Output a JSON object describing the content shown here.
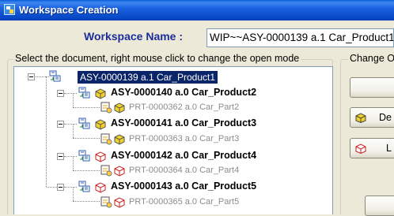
{
  "window": {
    "title": "Workspace Creation",
    "icon": "app-icon"
  },
  "workspace": {
    "label": "Workspace Name :",
    "value": "WIP~~ASY-0000139 a.1 Car_Product1"
  },
  "document_group": {
    "label": "Select the document, right mouse click to change the open mode"
  },
  "tree": {
    "root": {
      "label": "ASY-0000139 a.1 Car_Product1",
      "selected": true,
      "icon": "assembly-icon"
    },
    "children": [
      {
        "label": "ASY-0000140 a.0 Car_Product2",
        "status_icon": "yellow-product-icon",
        "child": {
          "label": "PRT-0000362 a.0 Car_Part2",
          "status_icon": "yellow-part-icon"
        }
      },
      {
        "label": "ASY-0000141 a.0 Car_Product3",
        "status_icon": "yellow-product-icon",
        "child": {
          "label": "PRT-0000363 a.0 Car_Part3",
          "status_icon": "yellow-part-icon"
        }
      },
      {
        "label": "ASY-0000142 a.0 Car_Product4",
        "status_icon": "red-product-icon",
        "child": {
          "label": "PRT-0000364 a.0 Car_Part4",
          "status_icon": "red-part-icon"
        }
      },
      {
        "label": "ASY-0000143 a.0 Car_Product5",
        "status_icon": "red-product-icon",
        "child": {
          "label": "PRT-0000365 a.0 Car_Part5",
          "status_icon": "red-part-icon"
        }
      }
    ]
  },
  "change_group": {
    "label": "Change O",
    "buttons": [
      {
        "label": ""
      },
      {
        "label": "De",
        "icon": "yellow-cube-icon"
      },
      {
        "label": "L",
        "icon": "red-cube-icon"
      }
    ]
  },
  "colors": {
    "title_bar": "#0a5fd8",
    "label_blue": "#1c2d9a",
    "selection": "#0a246a",
    "yellow_status": "#f2d22a",
    "red_status": "#c81e1e"
  }
}
